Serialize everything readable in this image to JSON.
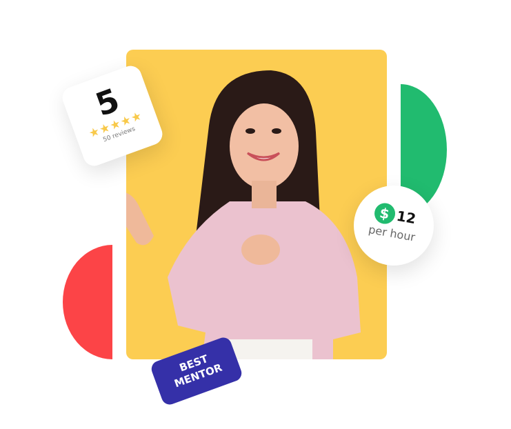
{
  "rating_card": {
    "score": "5",
    "stars": "★★★★★",
    "star_count": 5,
    "reviews": "50 reviews"
  },
  "price_card": {
    "currency_symbol": "$",
    "amount": "12",
    "unit": "per hour"
  },
  "badge": {
    "line1": "BEST",
    "line2": "MENTOR"
  },
  "colors": {
    "yellow": "#fccd52",
    "green": "#21bb6f",
    "red": "#fc4447",
    "badge": "#3530a8",
    "star": "#f8c94a"
  }
}
